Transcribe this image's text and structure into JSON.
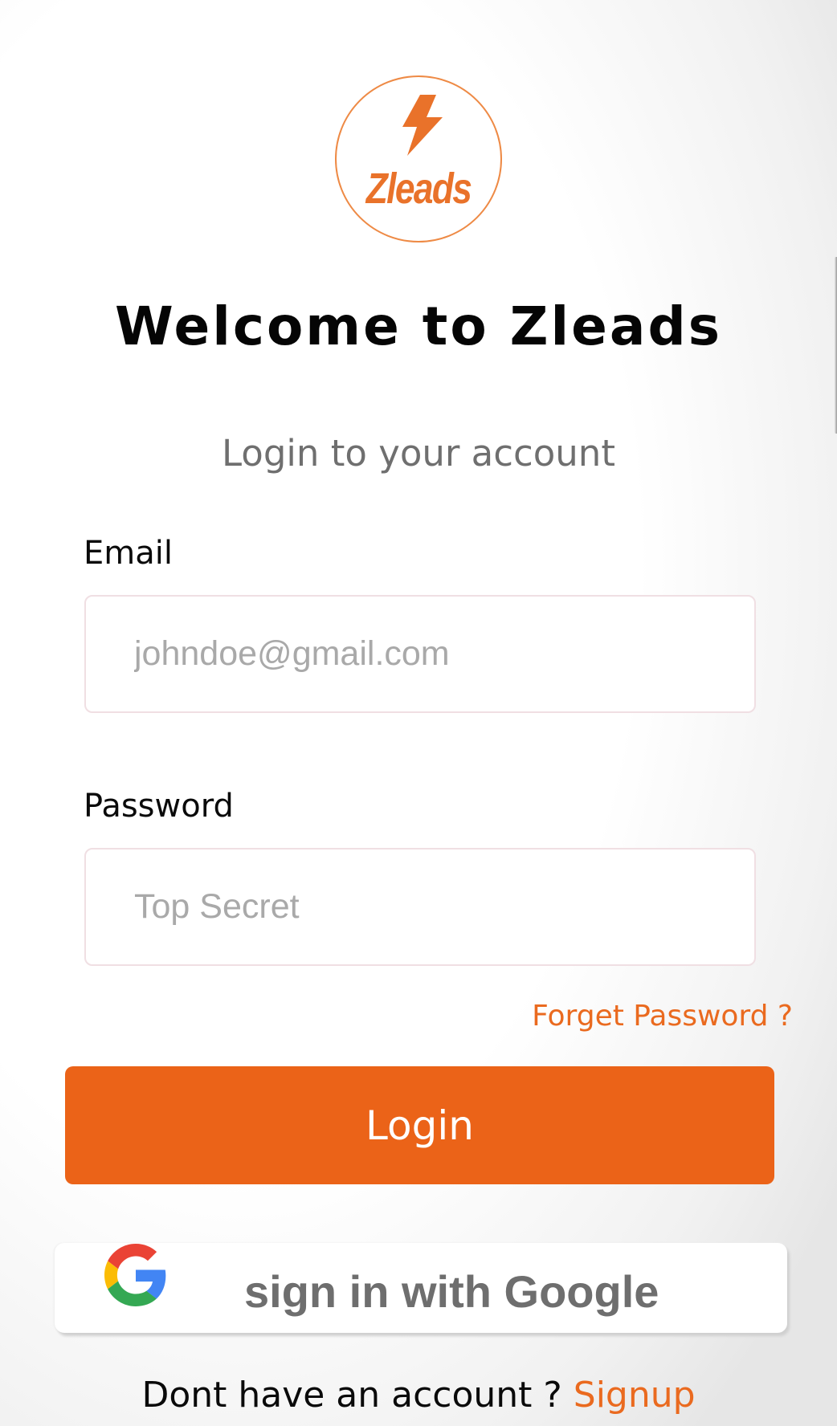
{
  "brand": {
    "logo_text": "Zleads",
    "accent_color": "#EB6318"
  },
  "welcome": {
    "title": "Welcome to Zleads",
    "subtitle": "Login to your account"
  },
  "form": {
    "email_label": "Email",
    "email_placeholder": "johndoe@gmail.com",
    "email_value": "",
    "password_label": "Password",
    "password_placeholder": "Top Secret",
    "password_value": "",
    "forget_password": "Forget Password ?"
  },
  "actions": {
    "login_label": "Login",
    "google_label": "sign in with Google",
    "google_icon": "google-g-icon"
  },
  "footer": {
    "prompt": "Dont have an account ? ",
    "signup_label": "Signup"
  }
}
